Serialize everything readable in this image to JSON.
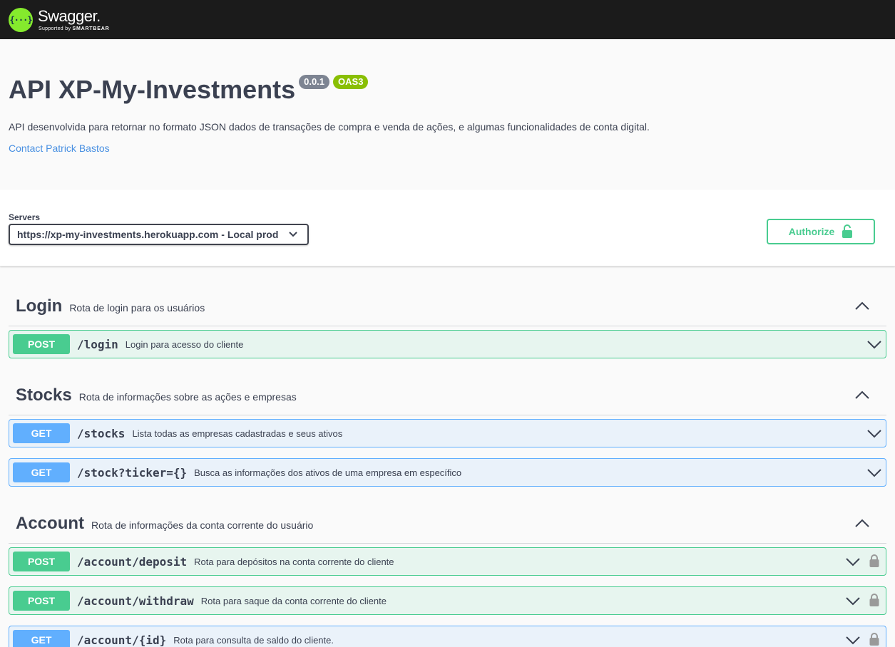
{
  "topbar": {
    "logo_glyph": "{···}",
    "logo_name": "Swagger.",
    "logo_sub_prefix": "Supported by",
    "logo_sub_brand": "SMARTBEAR"
  },
  "info": {
    "title": "API XP-My-Investments",
    "version": "0.0.1",
    "oas_badge": "OAS3",
    "description": "API desenvolvida para retornar no formato JSON dados de transações de compra e venda de ações, e algumas funcionalidades de conta digital.",
    "contact": "Contact Patrick Bastos"
  },
  "servers": {
    "label": "Servers",
    "selected": "https://xp-my-investments.herokuapp.com - Local prod"
  },
  "authorize": {
    "label": "Authorize"
  },
  "colors": {
    "post": "#49cc90",
    "get": "#61affe",
    "accent": "#85ea2d"
  },
  "tags": [
    {
      "name": "Login",
      "description": "Rota de login para os usuários",
      "operations": [
        {
          "method": "POST",
          "path": "/login",
          "summary": "Login para acesso do cliente"
        }
      ]
    },
    {
      "name": "Stocks",
      "description": "Rota de informações sobre as ações e empresas",
      "operations": [
        {
          "method": "GET",
          "path": "/stocks",
          "summary": "Lista todas as empresas cadastradas e seus ativos"
        },
        {
          "method": "GET",
          "path": "/stock?ticker={}",
          "summary": "Busca as informações dos ativos de uma empresa em específico"
        }
      ]
    },
    {
      "name": "Account",
      "description": "Rota de informações da conta corrente do usuário",
      "operations": [
        {
          "method": "POST",
          "path": "/account/deposit",
          "summary": "Rota para depósitos na conta corrente do cliente"
        },
        {
          "method": "POST",
          "path": "/account/withdraw",
          "summary": "Rota para saque da conta corrente do cliente"
        },
        {
          "method": "GET",
          "path": "/account/{id}",
          "summary": "Rota para consulta de saldo do cliente."
        }
      ]
    }
  ]
}
